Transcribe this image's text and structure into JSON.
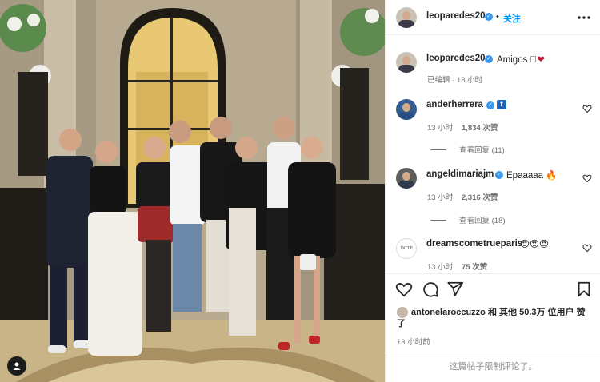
{
  "post": {
    "author": "leoparedes20",
    "follow_label": "关注",
    "dot": "•",
    "caption": "Amigos",
    "caption_emoji": "🏽❤",
    "caption_meta": "已编辑 · 13 小时"
  },
  "comments": [
    {
      "username": "anderherrera",
      "text": "",
      "time": "13 小时",
      "likes": "1,834 次赞",
      "replies": "查看回复 (11)"
    },
    {
      "username": "angeldimariajm",
      "text": "Epaaaaa 🔥",
      "time": "13 小时",
      "likes": "2,316 次赞",
      "replies": "查看回复 (18)"
    },
    {
      "username": "dreamscometrueparis",
      "text": "😍😍😍",
      "time": "13 小时",
      "likes": "75 次赞",
      "avatar_text": "DCTP"
    }
  ],
  "likes_line": {
    "prefix_user": "antonelaroccuzzo",
    "rest": "和 其他 50.3万 位用户 赞了"
  },
  "post_time": "13 小时前",
  "footer_text": "这篇帖子限制评论了。",
  "colors": {
    "link_blue": "#0095f6",
    "verified_blue": "#3897f0",
    "text_dark": "#262626",
    "text_muted": "#737373"
  },
  "icons": [
    "verified-icon",
    "more-options-icon",
    "heart-icon",
    "comment-icon",
    "share-icon",
    "bookmark-icon",
    "user-tag-icon"
  ]
}
